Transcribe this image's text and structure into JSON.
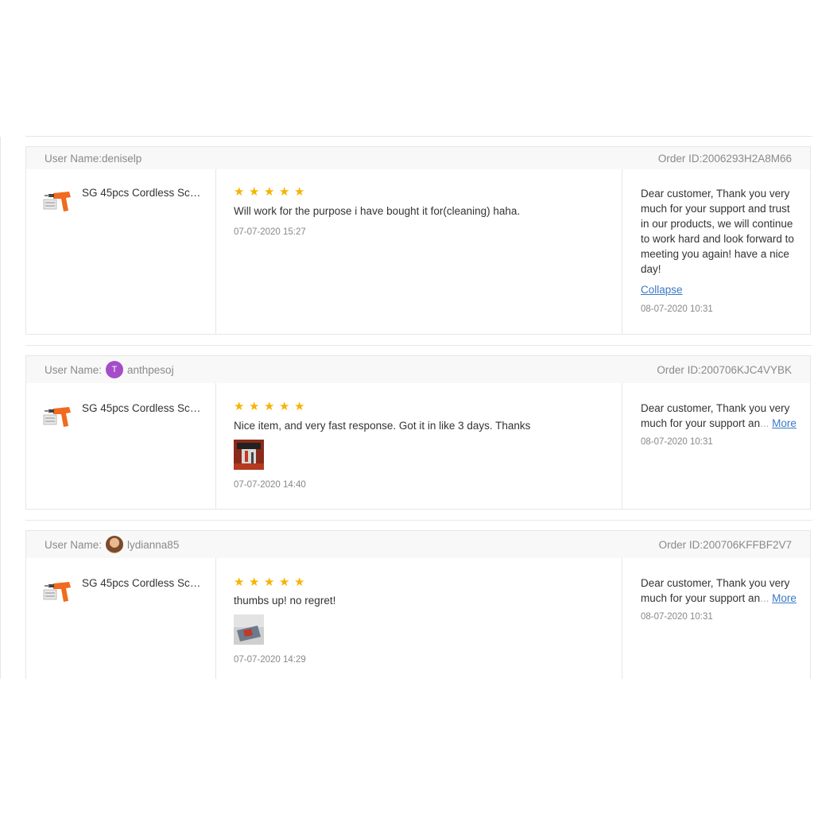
{
  "reviews": [
    {
      "user_label": "User Name:",
      "user_name": "deniselp",
      "avatar": "none",
      "order_id": "Order ID:2006293H2A8M66",
      "product_name": "SG 45pcs Cordless Scr...",
      "rating": 5,
      "review_text": "Will work for the purpose i have bought it for(cleaning) haha.",
      "review_date": "07-07-2020 15:27",
      "has_photo": false,
      "reply_text": "Dear customer, Thank you very much for your support and trust in our products, we will continue to work hard and look forward to meeting you again! have a nice day!",
      "reply_toggle": "Collapse",
      "reply_date": "08-07-2020 10:31"
    },
    {
      "user_label": "User Name:",
      "user_name": "anthpesoj",
      "avatar": "T",
      "order_id": "Order ID:200706KJC4VYBK",
      "product_name": "SG 45pcs Cordless Scr...",
      "rating": 5,
      "review_text": "Nice item, and very fast response. Got it in like 3 days. Thanks",
      "review_date": "07-07-2020 14:40",
      "has_photo": true,
      "reply_line1": "Dear customer, Thank you very",
      "reply_line2": "much for your support an",
      "reply_ellipsis": "...",
      "reply_toggle": "More",
      "reply_date": "08-07-2020 10:31"
    },
    {
      "user_label": "User Name:",
      "user_name": "lydianna85",
      "avatar": "photo",
      "order_id": "Order ID:200706KFFBF2V7",
      "product_name": "SG 45pcs Cordless Scr...",
      "rating": 5,
      "review_text": "thumbs up! no regret!",
      "review_date": "07-07-2020 14:29",
      "has_photo": true,
      "reply_line1": "Dear customer, Thank you very",
      "reply_line2": "much for your support an",
      "reply_ellipsis": "...",
      "reply_toggle": "More",
      "reply_date": "08-07-2020 10:31"
    }
  ],
  "icons": {
    "star": "star-icon",
    "product": "cordless-screwdriver-thumbnail"
  },
  "colors": {
    "star": "#f5b400",
    "link": "#3a79c3",
    "avatar_t": "#a64cc9"
  }
}
